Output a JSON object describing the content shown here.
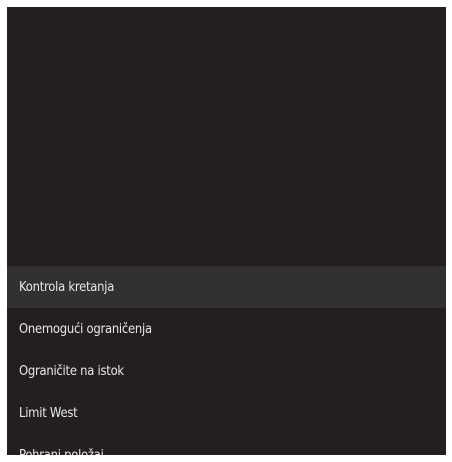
{
  "menu": {
    "items": [
      {
        "label": "Kontrola kretanja",
        "selected": true
      },
      {
        "label": "Onemogući ograničenja",
        "selected": false
      },
      {
        "label": "Ograničite na istok",
        "selected": false
      },
      {
        "label": "Limit West",
        "selected": false
      },
      {
        "label": "Pohrani položaj",
        "selected": false
      }
    ]
  },
  "colors": {
    "background": "#231f20",
    "selected_row": "#333030",
    "text": "#e8e8e8"
  }
}
